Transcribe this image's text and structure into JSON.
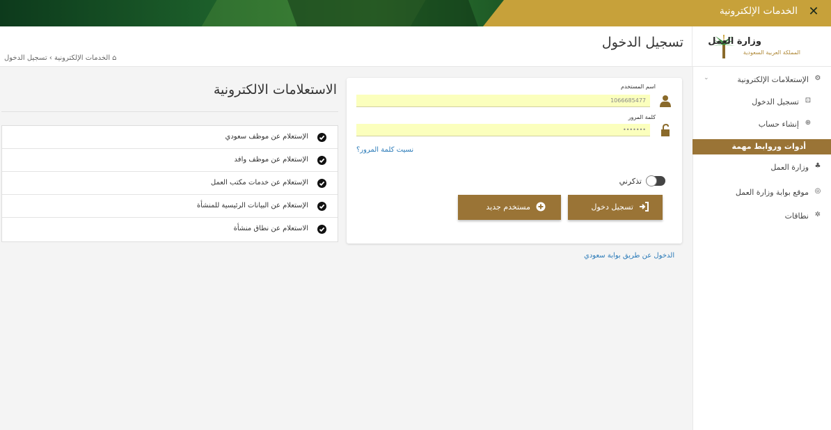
{
  "topbar": {
    "title": "الخدمات الإلكترونية",
    "close_icon": "close-icon"
  },
  "header": {
    "logo_name": "وزارة العمل",
    "logo_sub": "المملكة العربية السعودية",
    "page_title": "تسجيل الدخول",
    "breadcrumb": {
      "home": "الخدمات الإلكترونية",
      "separator": "›",
      "current": "تسجيل الدخول"
    }
  },
  "sidebar": {
    "items": [
      {
        "label": "الإستعلامات الإلكترونية",
        "icon": "gears-icon"
      },
      {
        "label": "تسجيل الدخول",
        "icon": "login-icon"
      },
      {
        "label": "إنشاء حساب",
        "icon": "plus-icon"
      },
      {
        "label": "أدوات وروابط مهمة",
        "icon": ""
      },
      {
        "label": "وزارة العمل",
        "icon": "palm-icon"
      },
      {
        "label": "موقع بوابة وزارة العمل",
        "icon": "globe-icon"
      },
      {
        "label": "نطاقات",
        "icon": "gear-icon"
      }
    ]
  },
  "login": {
    "username_label": "اسم المستخدم",
    "username_value": "1066685477",
    "password_label": "كلمة المرور",
    "password_value": "•••••••",
    "forgot": "نسيت كلمة المرور؟",
    "remember": "تذكرني",
    "login_button": "تسجيل دخول",
    "new_user_button": "مستخدم جديد",
    "saudi_link": "الدخول عن طريق بوابة سعودي"
  },
  "inquiries": {
    "title": "الاستعلامات الالكترونية",
    "items": [
      "الإستعلام عن موظف سعودي",
      "الإستعلام عن موظف وافد",
      "الإستعلام عن خدمات مكتب العمل",
      "الإستعلام عن البيانات الرئيسية للمنشأة",
      "الاستعلام عن نطاق منشأة"
    ]
  },
  "colors": {
    "brand_gold": "#9a7436",
    "banner_gold": "#c7a13a",
    "field_yellow": "#fbffbd",
    "link_blue": "#2a7ab8"
  }
}
